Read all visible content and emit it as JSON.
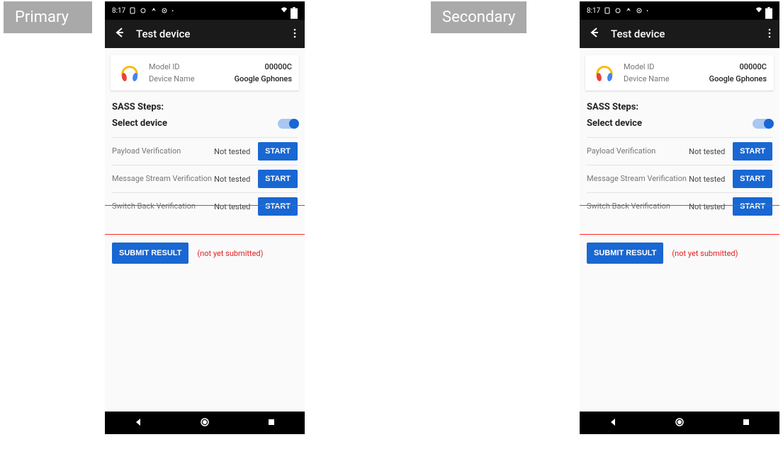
{
  "labels": {
    "primary": "Primary",
    "secondary": "Secondary"
  },
  "statusbar": {
    "time": "8:17"
  },
  "appbar": {
    "title": "Test device"
  },
  "card": {
    "model_label": "Model ID",
    "model_value": "00000C",
    "name_label": "Device Name",
    "name_value": "Google Gphones"
  },
  "section": {
    "sass_title": "SASS Steps:",
    "select_label": "Select device"
  },
  "tests": [
    {
      "name": "Payload Verification",
      "status": "Not tested",
      "action": "START"
    },
    {
      "name": "Message Stream Verification",
      "status": "Not tested",
      "action": "START"
    },
    {
      "name": "Switch Back Verification",
      "status": "Not tested",
      "action": "START"
    }
  ],
  "submit": {
    "button": "SUBMIT RESULT",
    "status": "(not yet submitted)"
  }
}
